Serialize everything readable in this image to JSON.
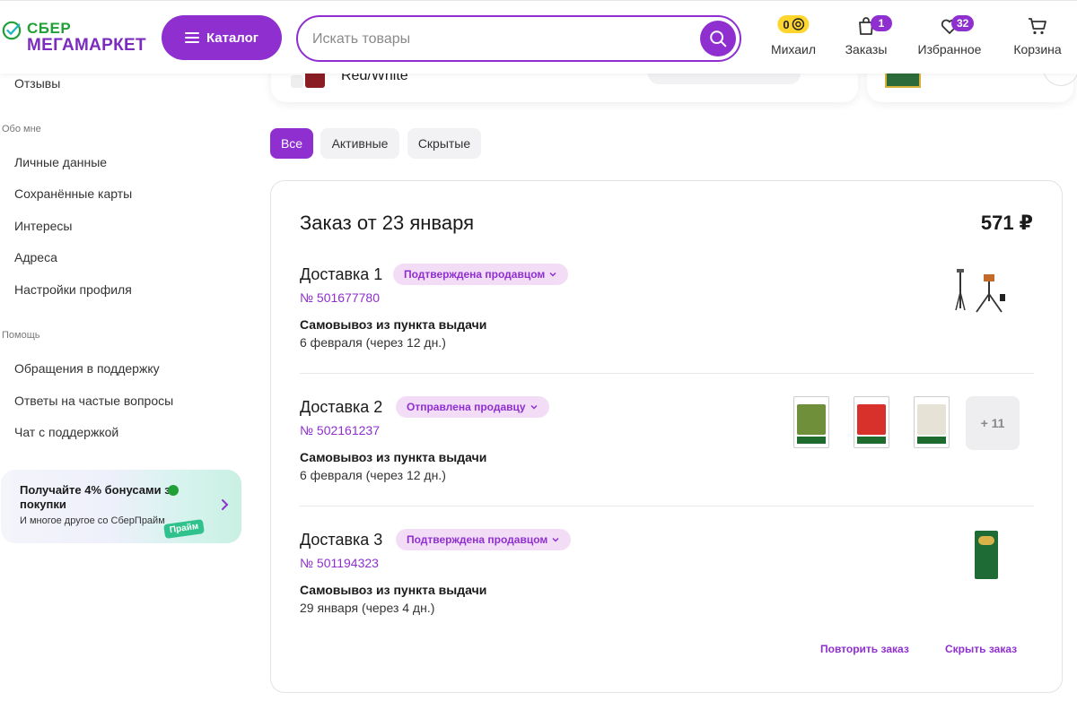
{
  "header": {
    "logo_top": "СБЕР",
    "logo_bottom": "МЕГАМАРКЕТ",
    "catalog_label": "Каталог",
    "search_placeholder": "Искать товары",
    "bonus_value": "0",
    "profile_label": "Михаил",
    "orders_label": "Заказы",
    "orders_badge": "1",
    "favorites_label": "Избранное",
    "favorites_badge": "32",
    "cart_label": "Корзина"
  },
  "sidebar": {
    "reviews": "Отзывы",
    "about_section": "Обо мне",
    "about_items": [
      "Личные данные",
      "Сохранённые карты",
      "Интересы",
      "Адреса",
      "Настройки профиля"
    ],
    "help_section": "Помощь",
    "help_items": [
      "Обращения в поддержку",
      "Ответы на частые вопросы",
      "Чат с поддержкой"
    ],
    "promo": {
      "title": "Получайте 4% бонусами за покупки",
      "subtitle": "И многое другое со СберПрайм",
      "chip": "Прайм"
    }
  },
  "top_strip": {
    "card_text": "Red/White"
  },
  "filters": {
    "all": "Все",
    "active": "Активные",
    "hidden": "Скрытые"
  },
  "order": {
    "title": "Заказ от 23 января",
    "total": "571 ₽",
    "deliveries": [
      {
        "title": "Доставка 1",
        "status": "Подтверждена продавцом",
        "number": "№ 501677780",
        "pickup": "Самовывоз из пункта выдачи",
        "date": "6 февраля (через 12 дн.)"
      },
      {
        "title": "Доставка 2",
        "status": "Отправлена продавцу",
        "number": "№ 502161237",
        "pickup": "Самовывоз из пункта выдачи",
        "date": "6 февраля (через 12 дн.)",
        "more": "+ 11"
      },
      {
        "title": "Доставка 3",
        "status": "Подтверждена продавцом",
        "number": "№ 501194323",
        "pickup": "Самовывоз из пункта выдачи",
        "date": "29 января (через 4 дн.)"
      }
    ],
    "repeat_label": "Повторить заказ",
    "hide_label": "Скрыть заказ"
  },
  "colors": {
    "accent": "#8f2fd0",
    "sber_green": "#21a038",
    "bonus_yellow": "#ffd52e",
    "status_bg": "#f3ddf6"
  },
  "icons": [
    "sber-logo-icon",
    "menu-icon",
    "search-icon",
    "bonus-icon",
    "bag-icon",
    "heart-icon",
    "cart-icon",
    "chevron-down-icon",
    "chevron-right-icon"
  ]
}
